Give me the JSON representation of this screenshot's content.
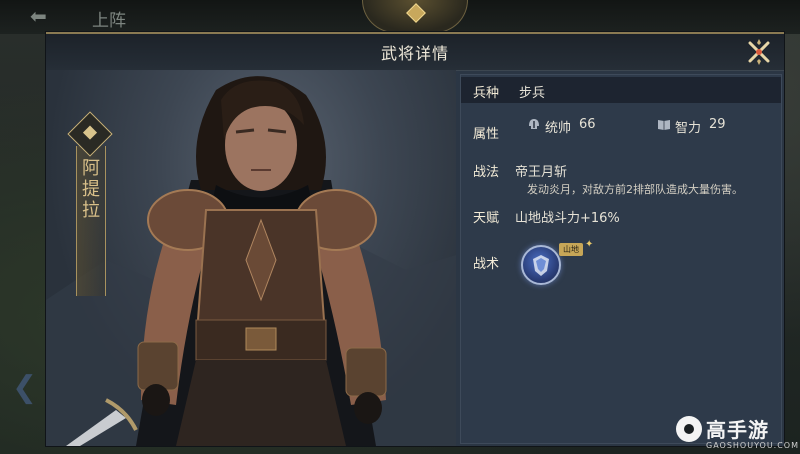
{
  "top_bar": {
    "back_label": "上阵"
  },
  "dialog": {
    "title": "武将详情"
  },
  "general": {
    "name": "阿提拉"
  },
  "info": {
    "type_label": "兵种",
    "type_value": "步兵",
    "attr_label": "属性",
    "stat1_name": "统帅",
    "stat1_value": "66",
    "stat2_name": "智力",
    "stat2_value": "29",
    "skill_label": "战法",
    "skill_name": "帝王月斩",
    "skill_desc": "发动炎月，对敌方前2排部队造成大量伤害。",
    "talent_label": "天赋",
    "talent_value": "山地战斗力+16%",
    "tactic_label": "战术",
    "tactic_tag": "山地"
  },
  "watermark": {
    "title": "高手游",
    "sub": "GAOSHOUYOU.COM"
  },
  "icons": {
    "close": "close-x-icon",
    "stat1": "helmet-icon",
    "stat2": "book-icon",
    "tactic": "shield-gem-icon",
    "logo": "gaoshouyou-logo"
  },
  "colors": {
    "accent_gold": "#c9b27a",
    "panel_bg": "#2e3a4a",
    "header_bg": "#1c2229"
  }
}
